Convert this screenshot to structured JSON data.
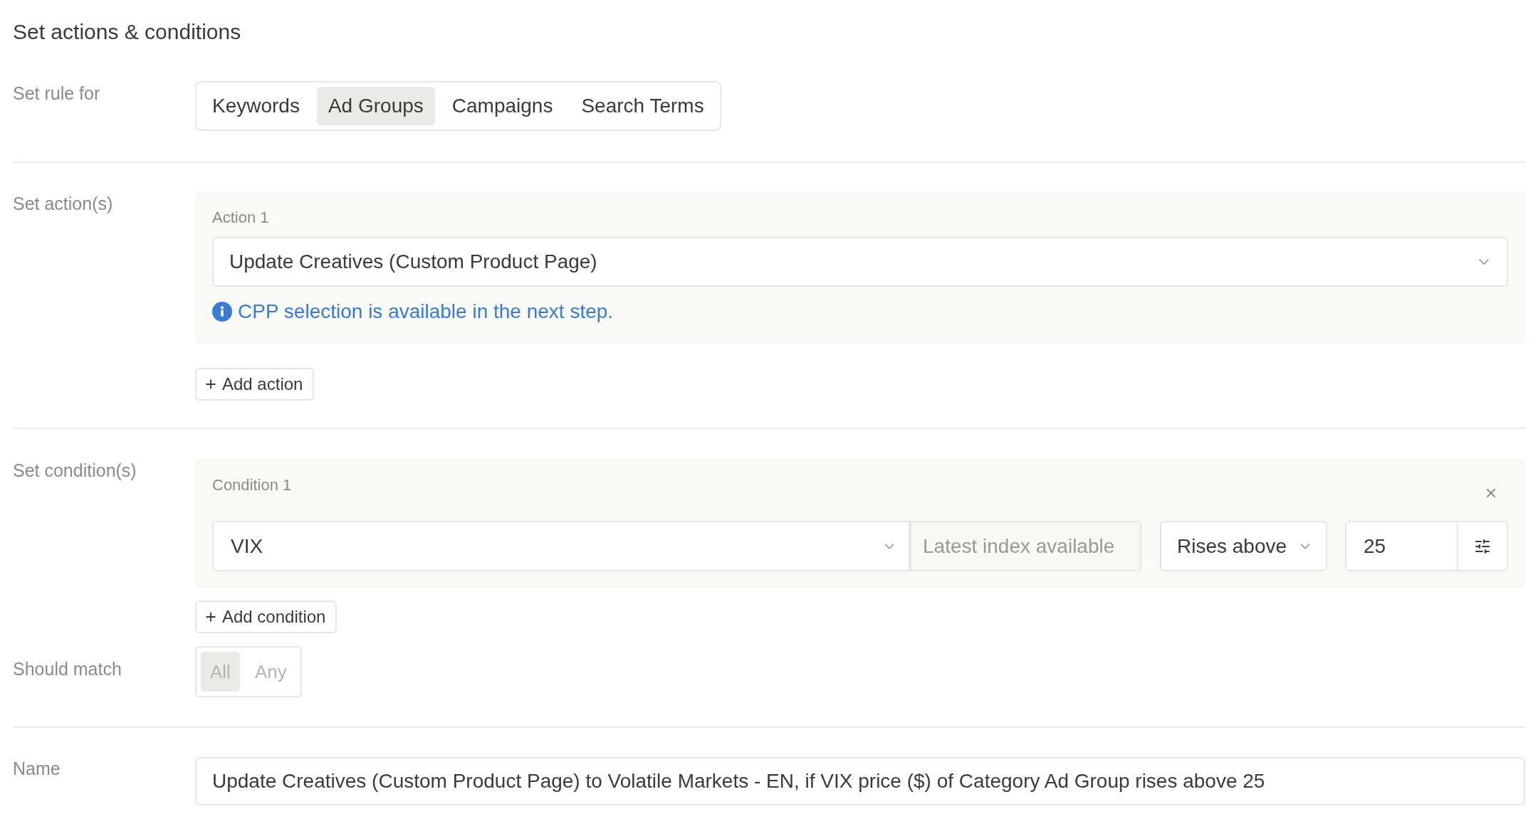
{
  "title": "Set actions & conditions",
  "rule_for": {
    "label": "Set rule for",
    "tabs": [
      {
        "label": "Keywords",
        "selected": false
      },
      {
        "label": "Ad Groups",
        "selected": true
      },
      {
        "label": "Campaigns",
        "selected": false
      },
      {
        "label": "Search Terms",
        "selected": false
      }
    ]
  },
  "actions": {
    "label": "Set action(s)",
    "items": [
      {
        "title": "Action 1",
        "value": "Update Creatives (Custom Product Page)",
        "note": "CPP selection is available in the next step."
      }
    ],
    "add_button": "Add action"
  },
  "conditions": {
    "label": "Set condition(s)",
    "items": [
      {
        "title": "Condition 1",
        "metric": "VIX",
        "timeframe": {
          "value": "Latest index available",
          "disabled": true
        },
        "operator": "Rises above",
        "value": "25"
      }
    ],
    "add_button": "Add condition"
  },
  "should_match": {
    "label": "Should match",
    "disabled": true,
    "options": [
      {
        "label": "All",
        "selected": true
      },
      {
        "label": "Any",
        "selected": false
      }
    ]
  },
  "name": {
    "label": "Name",
    "value": "Update Creatives (Custom Product Page) to Volatile Markets - EN, if VIX price ($) of Category Ad Group rises above 25"
  }
}
